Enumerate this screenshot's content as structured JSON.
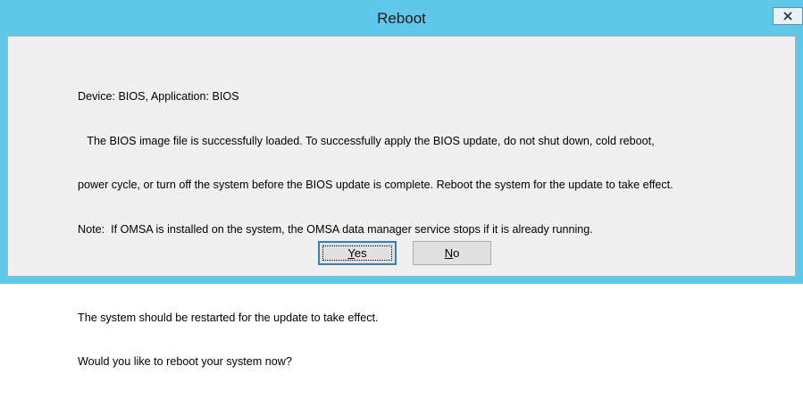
{
  "window": {
    "title": "Reboot",
    "close_label": "x"
  },
  "message": {
    "lines": [
      "Device: BIOS, Application: BIOS",
      "   The BIOS image file is successfully loaded. To successfully apply the BIOS update, do not shut down, cold reboot,",
      "power cycle, or turn off the system before the BIOS update is complete. Reboot the system for the update to take effect.",
      "Note:  If OMSA is installed on the system, the OMSA data manager service stops if it is already running.",
      "",
      "The system should be restarted for the update to take effect.",
      "Would you like to reboot your system now?"
    ]
  },
  "buttons": {
    "yes": {
      "mnemonic": "Y",
      "rest": "es"
    },
    "no": {
      "mnemonic": "N",
      "rest": "o"
    }
  },
  "colors": {
    "titlebar": "#5fc8ea",
    "client": "#f0f0f0",
    "button": "#e1e1e1",
    "default_button_border": "#3c7fb1"
  }
}
